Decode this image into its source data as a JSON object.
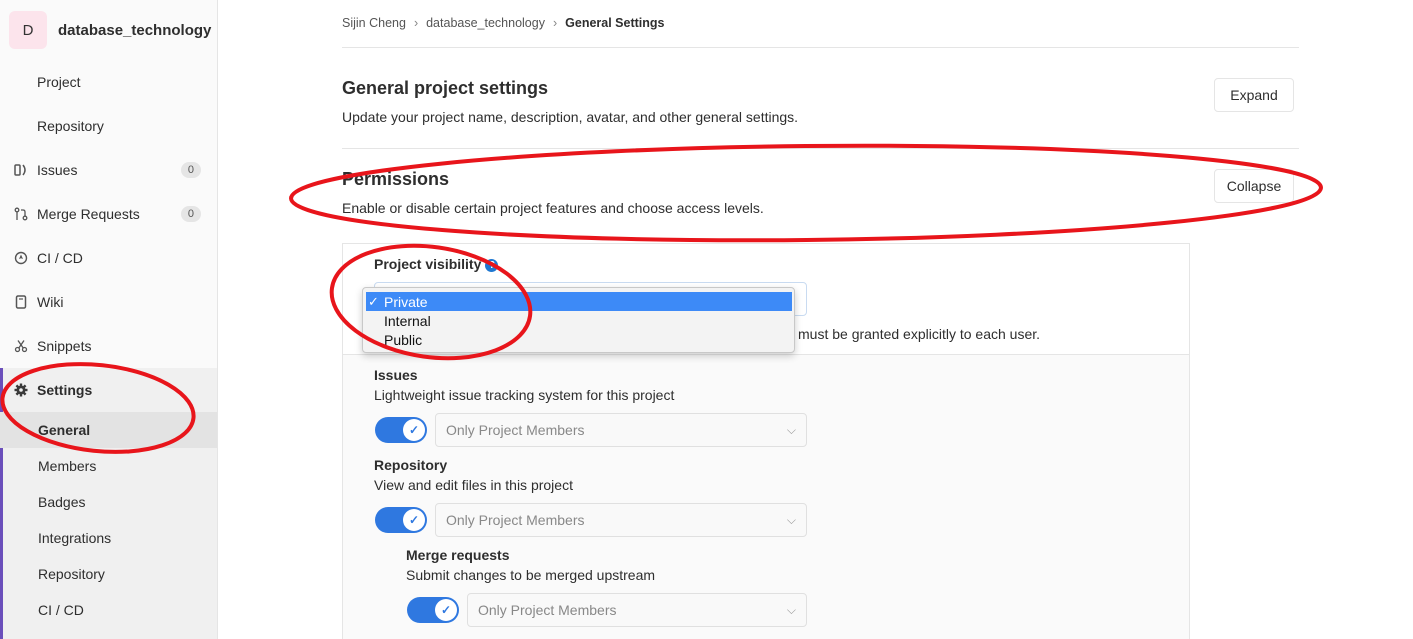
{
  "sidebar": {
    "avatar_letter": "D",
    "project_name": "database_technology",
    "items": [
      {
        "label": "Project",
        "icon": ""
      },
      {
        "label": "Repository",
        "icon": ""
      },
      {
        "label": "Issues",
        "icon": "issues-icon",
        "count": "0"
      },
      {
        "label": "Merge Requests",
        "icon": "merge-request-icon",
        "count": "0"
      },
      {
        "label": "CI / CD",
        "icon": "rocket-icon"
      },
      {
        "label": "Wiki",
        "icon": "book-icon"
      },
      {
        "label": "Snippets",
        "icon": "scissors-icon"
      },
      {
        "label": "Settings",
        "icon": "gear-icon"
      }
    ],
    "settings_sub": [
      "General",
      "Members",
      "Badges",
      "Integrations",
      "Repository",
      "CI / CD"
    ]
  },
  "breadcrumb": [
    "Sijin Cheng",
    "database_technology",
    "General Settings"
  ],
  "general": {
    "title": "General project settings",
    "description": "Update your project name, description, avatar, and other general settings.",
    "button": "Expand"
  },
  "permissions": {
    "title": "Permissions",
    "description": "Enable or disable certain project features and choose access levels.",
    "button": "Collapse",
    "visibility_label": "Project visibility",
    "visibility_options": [
      "Private",
      "Internal",
      "Public"
    ],
    "visibility_selected": "Private",
    "visibility_help_tail": "must be granted explicitly to each user.",
    "features": [
      {
        "label": "Issues",
        "help": "Lightweight issue tracking system for this project",
        "value": "Only Project Members"
      },
      {
        "label": "Repository",
        "help": "View and edit files in this project",
        "value": "Only Project Members"
      },
      {
        "label": "Merge requests",
        "help": "Submit changes to be merged upstream",
        "value": "Only Project Members"
      }
    ]
  },
  "colors": {
    "accent": "#6b4fbb",
    "toggle": "#2f78e0",
    "dropdown_selected": "#3d8af7",
    "annotation": "#e8151b"
  }
}
